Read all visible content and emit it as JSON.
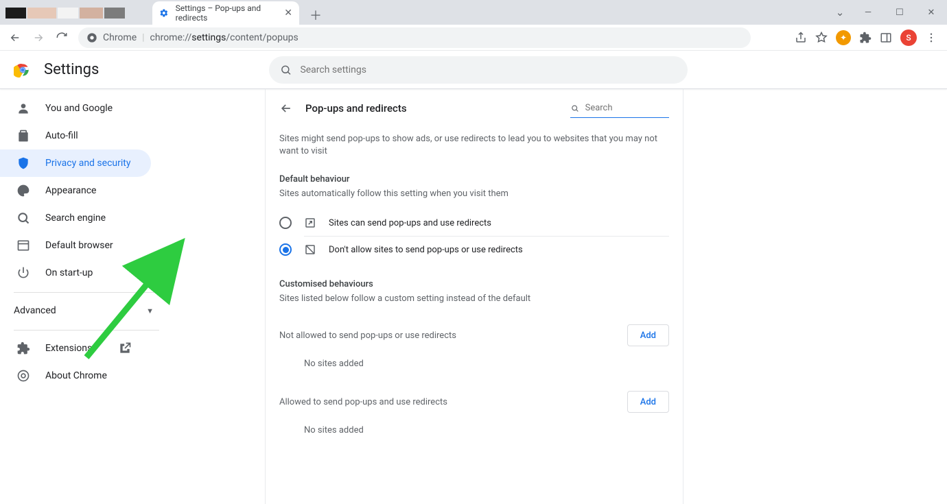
{
  "browser": {
    "tab_title": "Settings – Pop-ups and redirects",
    "omnibox_label": "Chrome",
    "omnibox_url_dim": "chrome://",
    "omnibox_url_bold": "settings",
    "omnibox_url_tail": "/content/popups",
    "profile_initial": "S"
  },
  "header": {
    "title": "Settings",
    "search_placeholder": "Search settings"
  },
  "sidebar": {
    "items": [
      {
        "label": "You and Google"
      },
      {
        "label": "Auto-fill"
      },
      {
        "label": "Privacy and security",
        "active": true
      },
      {
        "label": "Appearance"
      },
      {
        "label": "Search engine"
      },
      {
        "label": "Default browser"
      },
      {
        "label": "On start-up"
      }
    ],
    "advanced": "Advanced",
    "extensions": "Extensions",
    "about": "About Chrome"
  },
  "panel": {
    "title": "Pop-ups and redirects",
    "search_ph": "Search",
    "intro": "Sites might send pop-ups to show ads, or use redirects to lead you to websites that you may not want to visit",
    "default_title": "Default behaviour",
    "default_sub": "Sites automatically follow this setting when you visit them",
    "opt_allow": "Sites can send pop-ups and use redirects",
    "opt_block": "Don't allow sites to send pop-ups or use redirects",
    "custom_title": "Customised behaviours",
    "custom_sub": "Sites listed below follow a custom setting instead of the default",
    "not_allowed_label": "Not allowed to send pop-ups or use redirects",
    "allowed_label": "Allowed to send pop-ups and use redirects",
    "add_label": "Add",
    "empty": "No sites added"
  }
}
